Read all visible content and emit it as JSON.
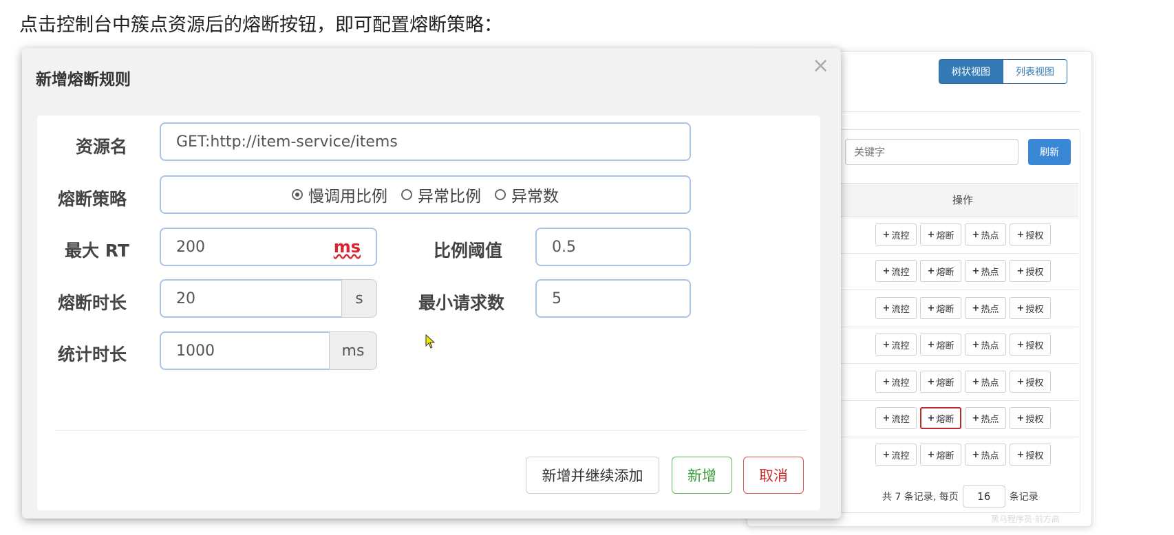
{
  "caption": "点击控制台中簇点资源后的熔断按钮，即可配置熔断策略：",
  "background_page": {
    "view_toggle": {
      "tree": "树状视图",
      "list": "列表视图"
    },
    "keyword_placeholder": "关键字",
    "refresh": "刷新",
    "column_ops": "操作",
    "row_ops": [
      "流控",
      "熔断",
      "热点",
      "授权"
    ],
    "row_count": 7,
    "pager": {
      "prefix": "共 7 条记录, 每页",
      "page_size": "16",
      "suffix": "条记录"
    },
    "watermark": "黑马程序员·前方高"
  },
  "modal": {
    "title": "新增熔断规则",
    "close": "×",
    "resource_label": "资源名",
    "resource_value": "GET:http://item-service/items",
    "strategy_label": "熔断策略",
    "strategies": [
      "慢调用比例",
      "异常比例",
      "异常数"
    ],
    "selected_strategy": "慢调用比例",
    "max_rt_label": "最大 RT",
    "max_rt_value": "200",
    "max_rt_unit": "ms",
    "ratio_label": "比例阈值",
    "ratio_value": "0.5",
    "duration_label": "熔断时长",
    "duration_value": "20",
    "duration_unit": "s",
    "min_requests_label": "最小请求数",
    "min_requests_value": "5",
    "stat_label": "统计时长",
    "stat_value": "1000",
    "stat_unit": "ms",
    "buttons": {
      "continue": "新增并继续添加",
      "add": "新增",
      "cancel": "取消"
    }
  }
}
